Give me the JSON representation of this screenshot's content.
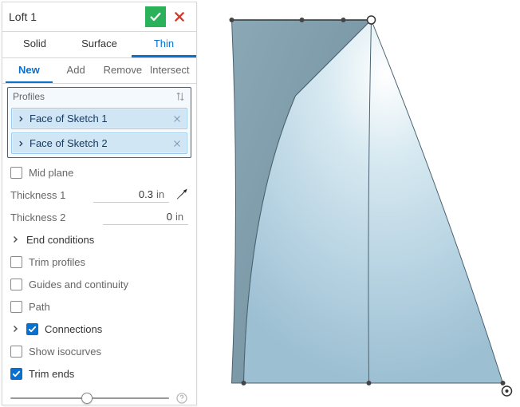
{
  "header": {
    "title": "Loft 1"
  },
  "tabs": {
    "items": [
      {
        "label": "Solid",
        "active": false
      },
      {
        "label": "Surface",
        "active": false
      },
      {
        "label": "Thin",
        "active": true
      }
    ]
  },
  "subtabs": {
    "items": [
      {
        "label": "New",
        "active": true
      },
      {
        "label": "Add",
        "active": false
      },
      {
        "label": "Remove",
        "active": false
      },
      {
        "label": "Intersect",
        "active": false
      }
    ]
  },
  "profiles": {
    "header": "Profiles",
    "items": [
      {
        "label": "Face of Sketch 1"
      },
      {
        "label": "Face of Sketch 2"
      }
    ]
  },
  "options": {
    "mid_plane": {
      "label": "Mid plane",
      "checked": false
    },
    "thickness1": {
      "label": "Thickness 1",
      "value": "0.3",
      "unit": "in"
    },
    "thickness2": {
      "label": "Thickness 2",
      "value": "0",
      "unit": "in"
    },
    "end_conditions": {
      "label": "End conditions"
    },
    "trim_profiles": {
      "label": "Trim profiles",
      "checked": false
    },
    "guides": {
      "label": "Guides and continuity",
      "checked": false
    },
    "path": {
      "label": "Path",
      "checked": false
    },
    "connections": {
      "label": "Connections",
      "checked": true
    },
    "show_iso": {
      "label": "Show isocurves",
      "checked": false
    },
    "trim_ends": {
      "label": "Trim ends",
      "checked": true
    }
  },
  "slider": {
    "position_pct": 48
  },
  "colors": {
    "accent": "#0871d0",
    "confirm": "#2bb15a",
    "cancel": "#d43a2a"
  }
}
